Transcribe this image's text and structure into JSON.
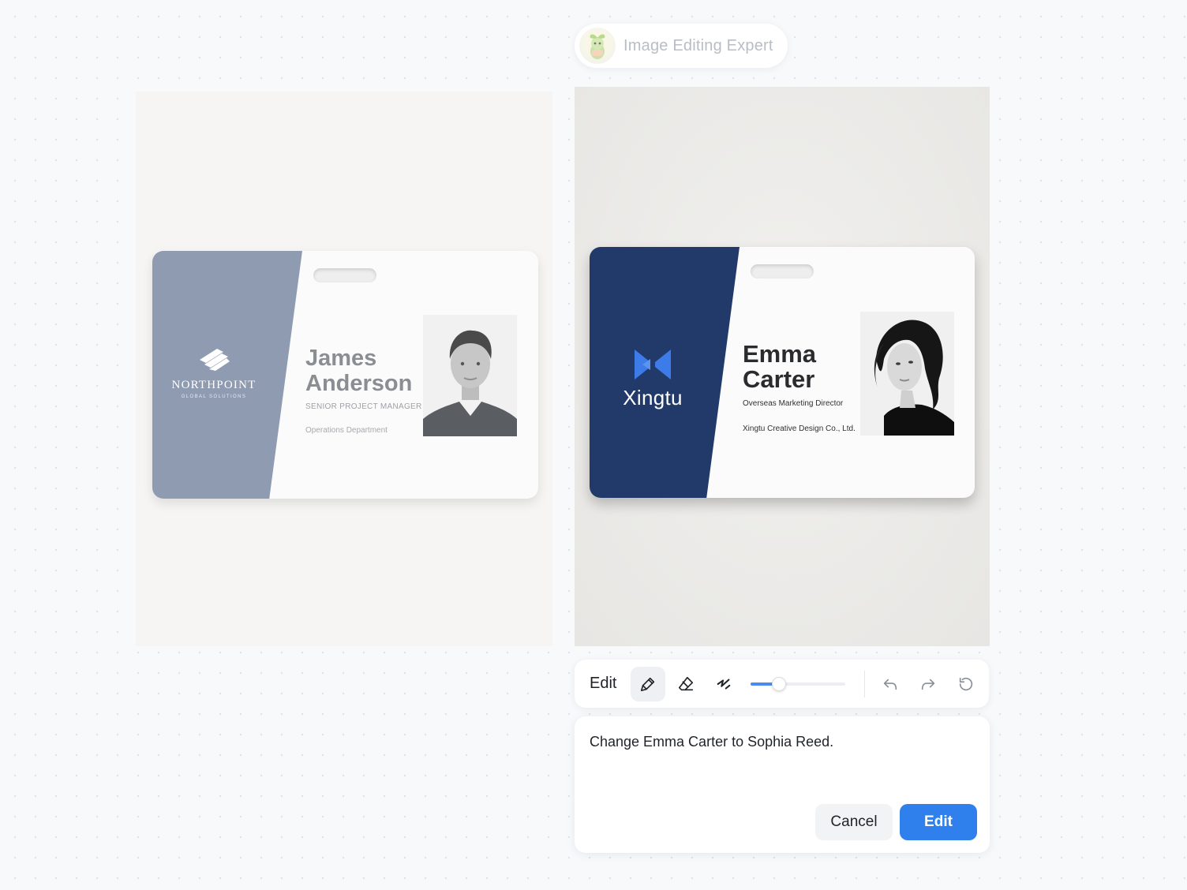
{
  "agent": {
    "name": "Image Editing Expert",
    "avatar_icon": "sprout-mascot-icon"
  },
  "original_card": {
    "company": "NORTHPOINT",
    "company_sub": "GLOBAL SOLUTIONS",
    "first_name": "James",
    "last_name": "Anderson",
    "title": "SENIOR PROJECT MANAGER",
    "department": "Operations Department",
    "stripe_color": "#8e9bb1"
  },
  "edited_card": {
    "company": "Xingtu",
    "first_name": "Emma",
    "last_name": "Carter",
    "title": "Overseas Marketing Director",
    "department": "Xingtu Creative Design Co., Ltd.",
    "stripe_color": "#223a6a",
    "logo_color": "#3d7be8"
  },
  "toolbar": {
    "title": "Edit",
    "tools": [
      {
        "name": "brush",
        "icon": "brush-icon",
        "active": true
      },
      {
        "name": "eraser",
        "icon": "eraser-icon",
        "active": false
      },
      {
        "name": "stroke",
        "icon": "stroke-size-icon",
        "active": false
      }
    ],
    "brush_size": 0.3,
    "history": [
      "undo-icon",
      "redo-icon",
      "reset-icon"
    ]
  },
  "prompt": {
    "text": "Change Emma Carter to Sophia Reed.",
    "cancel_label": "Cancel",
    "submit_label": "Edit"
  },
  "colors": {
    "accent": "#2f80ed",
    "slider": "#4a8bf0"
  }
}
